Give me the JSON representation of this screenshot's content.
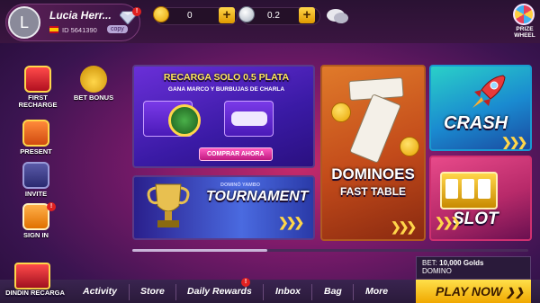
{
  "profile": {
    "avatar_initial": "L",
    "name": "Lucia Herr...",
    "id_text": "ID 5641390",
    "copy_label": "copy",
    "vip_badge": "!"
  },
  "currency": {
    "gold_value": "0",
    "silver_value": "0.2"
  },
  "prize_wheel": {
    "label": "PRIZE WHEEL"
  },
  "sidebar": {
    "items": [
      {
        "label": "FIRST RECHARGE",
        "icon": "gift-box-icon"
      },
      {
        "label": "BET BONUS",
        "icon": "coin-bag-icon"
      },
      {
        "label": "PRESENT",
        "icon": "present-icon"
      },
      {
        "label": "INVITE",
        "icon": "invite-envelope-icon"
      },
      {
        "label": "SIGN IN",
        "icon": "calendar-icon",
        "badge": "!"
      }
    ]
  },
  "promo": {
    "title": "RECARGA SOLO 0.5 PLATA",
    "subtitle": "GANA MARCO Y BURBUJAS DE CHARLA",
    "cta": "COMPRAR AHORA"
  },
  "games": {
    "tournament": "TOURNAMENT",
    "tournament_small": "DOMINÓ YAMBO",
    "dominoes_title": "DOMINOES",
    "dominoes_sub": "FAST TABLE",
    "crash": "CRASH",
    "slot": "SLOT"
  },
  "bottom": {
    "promo_label": "DINDIN RECARGA",
    "tabs": [
      "Activity",
      "Store",
      "Daily Rewards",
      "Inbox",
      "Bag",
      "More"
    ],
    "daily_badge": "!",
    "bet_label": "BET:",
    "bet_value": "10,000 Golds",
    "bet_game": "DOMINO",
    "play_now": "PLAY NOW"
  },
  "colors": {
    "accent_gold": "#ffd64a",
    "badge_red": "#e02020",
    "background": "#7a1a6a"
  }
}
